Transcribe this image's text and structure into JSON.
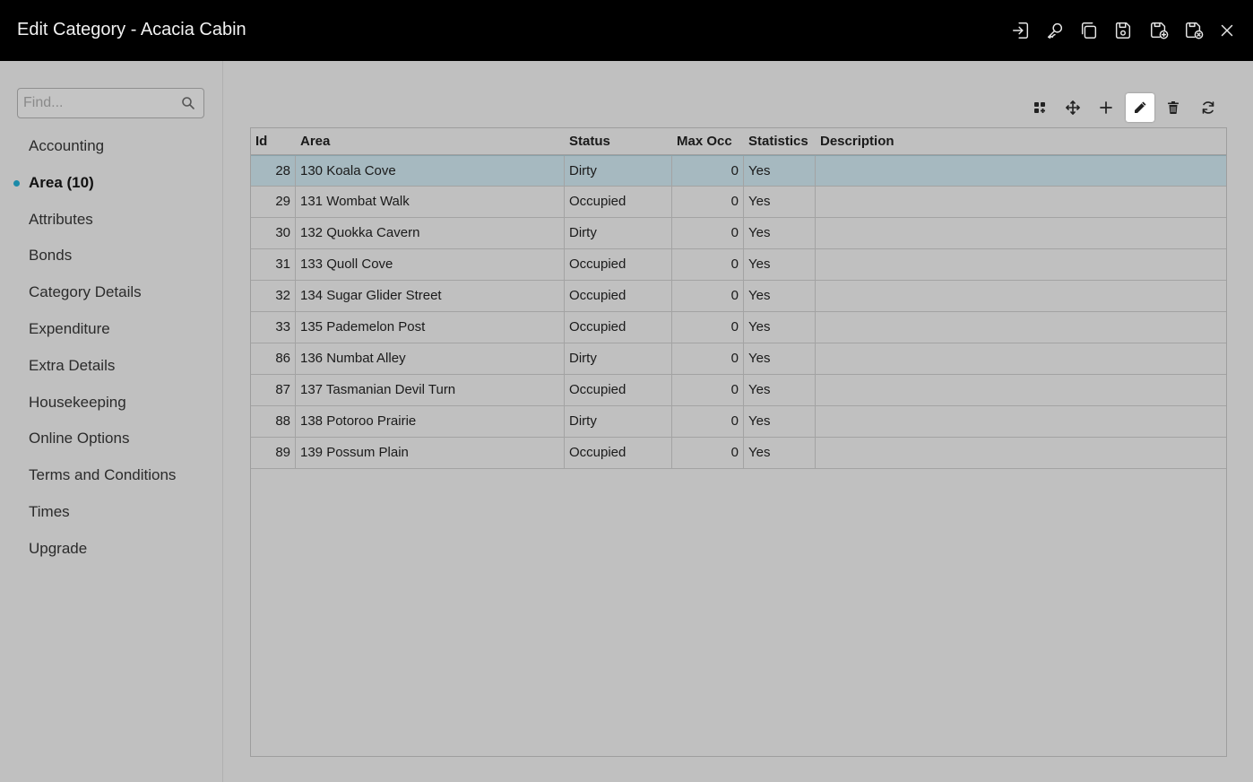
{
  "window": {
    "title": "Edit Category - Acacia Cabin",
    "title_icons": [
      "sign-in-icon",
      "key-icon",
      "copy-icon",
      "save-icon",
      "save-and-new-icon",
      "save-and-close-icon",
      "close-icon"
    ]
  },
  "sidebar": {
    "search_placeholder": "Find...",
    "items": [
      {
        "label": "Accounting"
      },
      {
        "label": "Area (10)",
        "active": true
      },
      {
        "label": "Attributes"
      },
      {
        "label": "Bonds"
      },
      {
        "label": "Category Details"
      },
      {
        "label": "Expenditure"
      },
      {
        "label": "Extra Details"
      },
      {
        "label": "Housekeeping"
      },
      {
        "label": "Online Options"
      },
      {
        "label": "Terms and Conditions"
      },
      {
        "label": "Times"
      },
      {
        "label": "Upgrade"
      }
    ]
  },
  "toolbar": {
    "buttons": [
      "add-multiple-icon",
      "move-icon",
      "add-icon",
      "edit-icon",
      "delete-icon",
      "refresh-icon"
    ],
    "selected": "edit-icon"
  },
  "grid": {
    "columns": [
      "Id",
      "Area",
      "Status",
      "Max Occ",
      "Statistics",
      "Description"
    ],
    "rows": [
      {
        "id": "28",
        "area": "130 Koala Cove",
        "status": "Dirty",
        "max_occ": "0",
        "statistics": "Yes",
        "description": "",
        "selected": true
      },
      {
        "id": "29",
        "area": "131 Wombat Walk",
        "status": "Occupied",
        "max_occ": "0",
        "statistics": "Yes",
        "description": ""
      },
      {
        "id": "30",
        "area": "132 Quokka Cavern",
        "status": "Dirty",
        "max_occ": "0",
        "statistics": "Yes",
        "description": ""
      },
      {
        "id": "31",
        "area": "133 Quoll Cove",
        "status": "Occupied",
        "max_occ": "0",
        "statistics": "Yes",
        "description": ""
      },
      {
        "id": "32",
        "area": "134 Sugar Glider Street",
        "status": "Occupied",
        "max_occ": "0",
        "statistics": "Yes",
        "description": ""
      },
      {
        "id": "33",
        "area": "135 Pademelon Post",
        "status": "Occupied",
        "max_occ": "0",
        "statistics": "Yes",
        "description": ""
      },
      {
        "id": "86",
        "area": "136 Numbat Alley",
        "status": "Dirty",
        "max_occ": "0",
        "statistics": "Yes",
        "description": ""
      },
      {
        "id": "87",
        "area": "137 Tasmanian Devil Turn",
        "status": "Occupied",
        "max_occ": "0",
        "statistics": "Yes",
        "description": ""
      },
      {
        "id": "88",
        "area": "138 Potoroo Prairie",
        "status": "Dirty",
        "max_occ": "0",
        "statistics": "Yes",
        "description": ""
      },
      {
        "id": "89",
        "area": "139 Possum Plain",
        "status": "Occupied",
        "max_occ": "0",
        "statistics": "Yes",
        "description": ""
      }
    ]
  },
  "colors": {
    "titlebar": "#000000",
    "background": "#c0c0c0",
    "selected_row": "#a6b9c0",
    "active_dot": "#1b8aa8"
  }
}
